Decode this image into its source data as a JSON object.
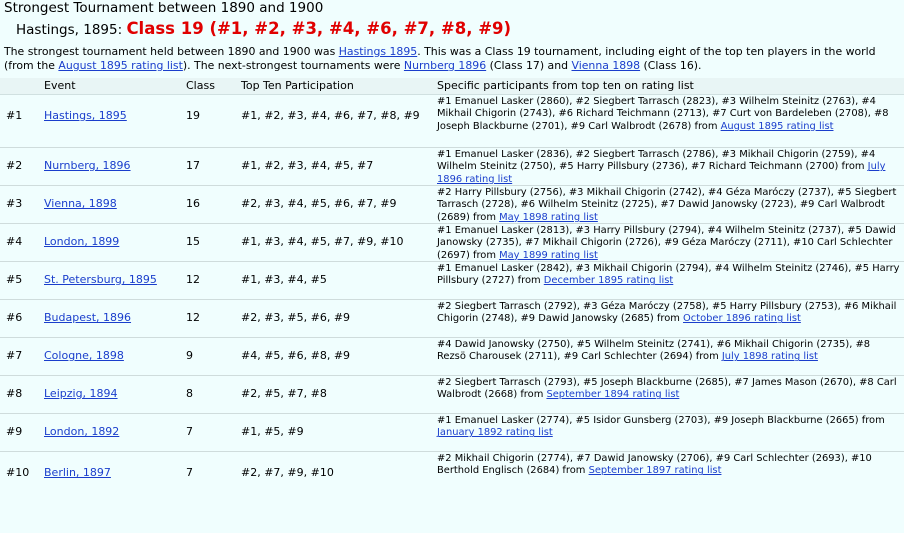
{
  "page": {
    "title": "Strongest Tournament between 1890 and 1900",
    "subtitle_prefix": "Hastings, 1895:",
    "subtitle_class": "Class 19 (#1, #2, #3, #4, #6, #7, #8, #9)"
  },
  "intro": {
    "t1": "The strongest tournament held between 1890 and 1900 was ",
    "l1": "Hastings 1895",
    "t2": ". This was a Class 19 tournament, including eight of the top ten players in the world (from the ",
    "l2": "August 1895 rating list",
    "t3": "). The next-strongest tournaments were ",
    "l3": "Nurnberg 1896",
    "t4": " (Class 17) and ",
    "l4": "Vienna 1898",
    "t5": " (Class 16)."
  },
  "table": {
    "headers": {
      "event": "Event",
      "class": "Class",
      "topten": "Top Ten Participation",
      "participants": "Specific participants from top ten on rating list"
    },
    "rows": [
      {
        "rank": "#1",
        "event": "Hastings, 1895",
        "cls": "19",
        "topten": "#1, #2, #3, #4, #6, #7, #8, #9",
        "participants": "#1 Emanuel Lasker (2860), #2 Siegbert Tarrasch (2823), #3 Wilhelm Steinitz (2763), #4 Mikhail Chigorin (2743), #6 Richard Teichmann (2713), #7 Curt von Bardeleben (2708), #8 Joseph Blackburne (2701), #9 Carl Walbrodt (2678) from ",
        "list": "August 1895 rating list"
      },
      {
        "rank": "#2",
        "event": "Nurnberg, 1896",
        "cls": "17",
        "topten": "#1, #2, #3, #4, #5, #7",
        "participants": "#1 Emanuel Lasker (2836), #2 Siegbert Tarrasch (2786), #3 Mikhail Chigorin (2759), #4 Wilhelm Steinitz (2750), #5 Harry Pillsbury (2736), #7 Richard Teichmann (2700) from ",
        "list": "July 1896 rating list"
      },
      {
        "rank": "#3",
        "event": "Vienna, 1898",
        "cls": "16",
        "topten": "#2, #3, #4, #5, #6, #7, #9",
        "participants": "#2 Harry Pillsbury (2756), #3 Mikhail Chigorin (2742), #4 Géza Maróczy (2737), #5 Siegbert Tarrasch (2728), #6 Wilhelm Steinitz (2725), #7 Dawid Janowsky (2723), #9 Carl Walbrodt (2689) from ",
        "list": "May 1898 rating list"
      },
      {
        "rank": "#4",
        "event": "London, 1899",
        "cls": "15",
        "topten": "#1, #3, #4, #5, #7, #9, #10",
        "participants": "#1 Emanuel Lasker (2813), #3 Harry Pillsbury (2794), #4 Wilhelm Steinitz (2737), #5 Dawid Janowsky (2735), #7 Mikhail Chigorin (2726), #9 Géza Maróczy (2711), #10 Carl Schlechter (2697) from ",
        "list": "May 1899 rating list"
      },
      {
        "rank": "#5",
        "event": "St. Petersburg, 1895",
        "cls": "12",
        "topten": "#1, #3, #4, #5",
        "participants": "#1 Emanuel Lasker (2842), #3 Mikhail Chigorin (2794), #4 Wilhelm Steinitz (2746), #5 Harry Pillsbury (2727) from ",
        "list": "December 1895 rating list"
      },
      {
        "rank": "#6",
        "event": "Budapest, 1896",
        "cls": "12",
        "topten": "#2, #3, #5, #6, #9",
        "participants": "#2 Siegbert Tarrasch (2792), #3 Géza Maróczy (2758), #5 Harry Pillsbury (2753), #6 Mikhail Chigorin (2748), #9 Dawid Janowsky (2685) from ",
        "list": "October 1896 rating list"
      },
      {
        "rank": "#7",
        "event": "Cologne, 1898",
        "cls": "9",
        "topten": "#4, #5, #6, #8, #9",
        "participants": "#4 Dawid Janowsky (2750), #5 Wilhelm Steinitz (2741), #6 Mikhail Chigorin (2735), #8 Rezsö Charousek (2711), #9 Carl Schlechter (2694) from ",
        "list": "July 1898 rating list"
      },
      {
        "rank": "#8",
        "event": "Leipzig, 1894",
        "cls": "8",
        "topten": "#2, #5, #7, #8",
        "participants": "#2 Siegbert Tarrasch (2793), #5 Joseph Blackburne (2685), #7 James Mason (2670), #8 Carl Walbrodt (2668) from ",
        "list": "September 1894 rating list"
      },
      {
        "rank": "#9",
        "event": "London, 1892",
        "cls": "7",
        "topten": "#1, #5, #9",
        "participants": "#1 Emanuel Lasker (2774), #5 Isidor Gunsberg (2703), #9 Joseph Blackburne (2665) from ",
        "list": "January 1892 rating list"
      },
      {
        "rank": "#10",
        "event": "Berlin, 1897",
        "cls": "7",
        "topten": "#2, #7, #9, #10",
        "participants": "#2 Mikhail Chigorin (2774), #7 Dawid Janowsky (2706), #9 Carl Schlechter (2693), #10 Berthold Englisch (2684) from ",
        "list": "September 1897 rating list"
      }
    ]
  }
}
